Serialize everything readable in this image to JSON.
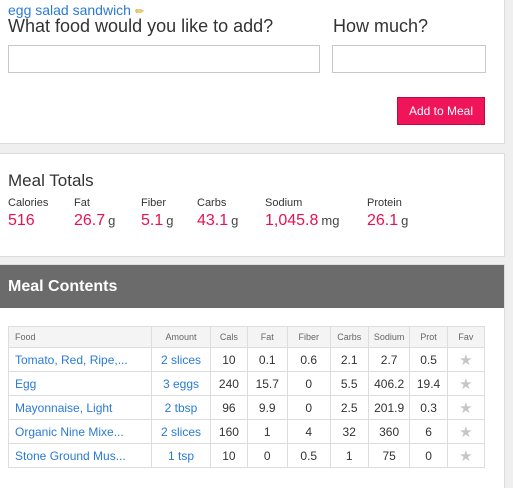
{
  "add_form": {
    "meal_name": "egg salad sandwich",
    "food_label": "What food would you like to add?",
    "amount_label": "How much?",
    "food_value": "",
    "food_placeholder": "",
    "amount_value": "",
    "amount_placeholder": "",
    "add_button": "Add to Meal"
  },
  "totals": {
    "title": "Meal Totals",
    "calories": {
      "label": "Calories",
      "value": "516",
      "unit": ""
    },
    "fat": {
      "label": "Fat",
      "value": "26.7",
      "unit": "g"
    },
    "fiber": {
      "label": "Fiber",
      "value": "5.1",
      "unit": "g"
    },
    "carbs": {
      "label": "Carbs",
      "value": "43.1",
      "unit": "g"
    },
    "sodium": {
      "label": "Sodium",
      "value": "1,045.8",
      "unit": "mg"
    },
    "protein": {
      "label": "Protein",
      "value": "26.1",
      "unit": "g"
    }
  },
  "contents": {
    "title": "Meal Contents",
    "columns": [
      "Food",
      "Amount",
      "Cals",
      "Fat",
      "Fiber",
      "Carbs",
      "Sodium",
      "Prot",
      "Fav"
    ],
    "rows": [
      [
        "Tomato, Red, Ripe,...",
        "2 slices",
        "10",
        "0.1",
        "0.6",
        "2.1",
        "2.7",
        "0.5"
      ],
      [
        "Egg",
        "3 eggs",
        "240",
        "15.7",
        "0",
        "5.5",
        "406.2",
        "19.4"
      ],
      [
        "Mayonnaise, Light",
        "2 tbsp",
        "96",
        "9.9",
        "0",
        "2.5",
        "201.9",
        "0.3"
      ],
      [
        "Organic Nine Mixe...",
        "2 slices",
        "160",
        "1",
        "4",
        "32",
        "360",
        "6"
      ],
      [
        "Stone Ground Mus...",
        "1 tsp",
        "10",
        "0",
        "0.5",
        "1",
        "75",
        "0"
      ]
    ],
    "fav_icon": "star-icon",
    "fav_glyph": "★"
  },
  "colors": {
    "accent": "#f0145a",
    "link": "#2a7ad6",
    "header_bar": "#6b6b6b"
  }
}
